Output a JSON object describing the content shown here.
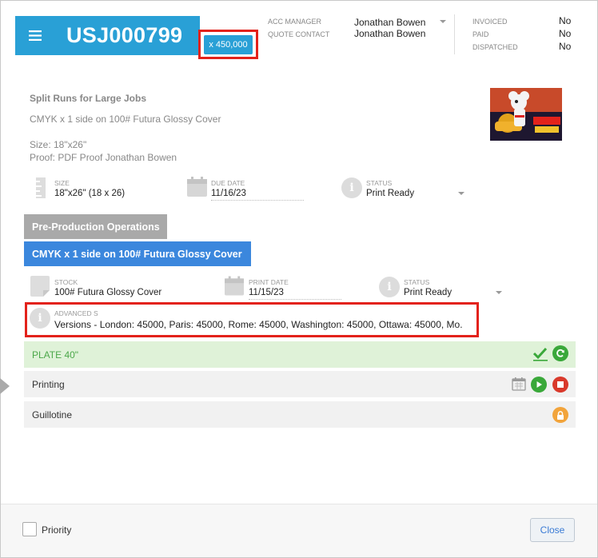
{
  "header": {
    "job_number": "USJ000799",
    "quantity_badge": "x 450,000",
    "acc_manager_label": "ACC MANAGER",
    "acc_manager_value": "Jonathan Bowen",
    "quote_contact_label": "QUOTE CONTACT",
    "quote_contact_value": "Jonathan Bowen",
    "invoiced_label": "INVOICED",
    "invoiced_value": "No",
    "paid_label": "PAID",
    "paid_value": "No",
    "dispatched_label": "DISPATCHED",
    "dispatched_value": "No"
  },
  "job": {
    "title": "Split Runs for Large Jobs",
    "description": "CMYK x 1 side  on 100# Futura Glossy Cover",
    "size_line": "Size: 18\"x26\"",
    "proof_line": "Proof: PDF Proof Jonathan Bowen",
    "thumbnail_text": "DANGER MOUSE",
    "size_label": "SIZE",
    "size_value": "18\"x26\" (18 x 26)",
    "due_date_label": "DUE DATE",
    "due_date_value": "11/16/23",
    "status_label": "STATUS",
    "status_value": "Print Ready"
  },
  "sections": {
    "pre_production": "Pre-Production Operations",
    "stock_section": "CMYK x 1 side on 100# Futura Glossy Cover"
  },
  "part": {
    "stock_label": "STOCK",
    "stock_value": "100# Futura Glossy Cover",
    "print_date_label": "PRINT DATE",
    "print_date_value": "11/15/23",
    "status_label": "STATUS",
    "status_value": "Print Ready",
    "advanced_label": "ADVANCED S",
    "advanced_value": "Versions - London: 45000, Paris: 45000, Rome: 45000, Washington: 45000, Ottawa: 45000, Mo..."
  },
  "operations": [
    {
      "name": "PLATE 40\""
    },
    {
      "name": "Printing"
    },
    {
      "name": "Guillotine"
    }
  ],
  "footer": {
    "priority_label": "Priority",
    "close_label": "Close"
  },
  "colors": {
    "brand_blue": "#29a0d6",
    "section_blue": "#3b87dd",
    "highlight_red": "#e3221b",
    "plate_green": "#4ca84a",
    "play_green": "#3aa83a",
    "stop_red": "#d9392b",
    "lock_orange": "#f2a43b"
  }
}
